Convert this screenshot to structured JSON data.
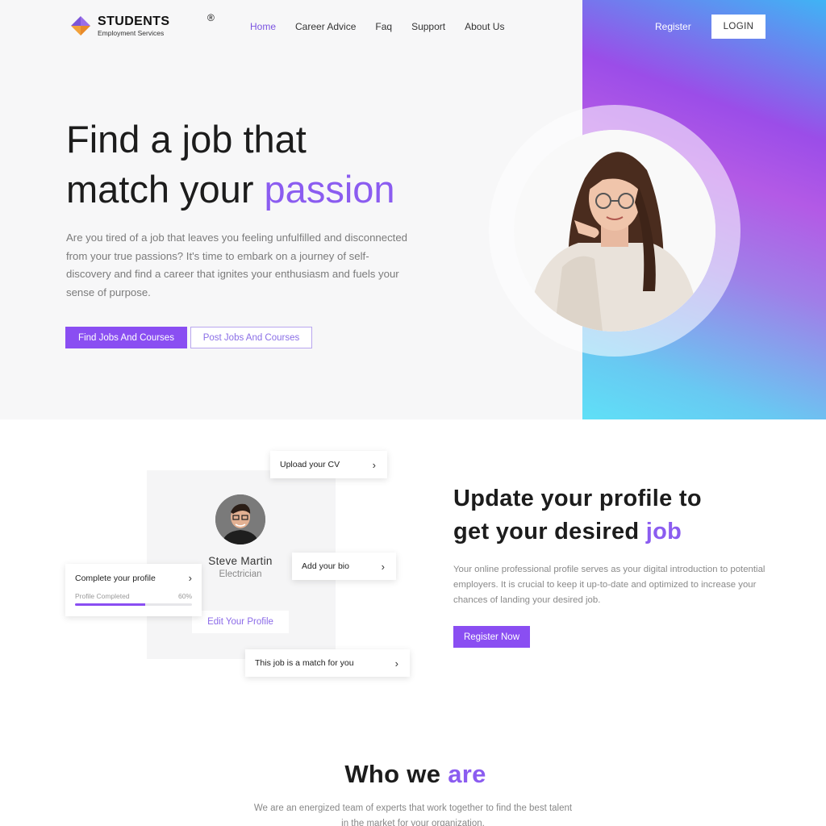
{
  "brand": {
    "name": "STUDENTS",
    "registered": "®",
    "subtitle": "Employment Services",
    "colors": {
      "primary": "#8a4ef2",
      "accent_text": "#8b5cf0",
      "gradient_start": "#3fb4f5",
      "gradient_end": "#5fe0f7"
    }
  },
  "nav": {
    "items": [
      {
        "label": "Home",
        "active": true
      },
      {
        "label": "Career Advice",
        "active": false
      },
      {
        "label": "Faq",
        "active": false
      },
      {
        "label": "Support",
        "active": false
      },
      {
        "label": "About Us",
        "active": false
      }
    ],
    "register_label": "Register",
    "login_label": "LOGIN"
  },
  "hero": {
    "title_line1": "Find a job that",
    "title_line2": "match your",
    "title_accent": "passion",
    "description": "Are you tired of a job that leaves you feeling unfulfilled and disconnected from your true passions? It's time to embark on a journey of self-discovery and find a career that ignites your enthusiasm and fuels your sense of purpose.",
    "primary_button": "Find Jobs And Courses",
    "secondary_button": "Post Jobs And Courses"
  },
  "profile_card": {
    "name": "Steve Martin",
    "role": "Electrician",
    "edit_button": "Edit Your Profile",
    "chips": {
      "upload_cv": "Upload your CV",
      "add_bio": "Add your bio",
      "job_match": "This job is a match for you"
    },
    "completion": {
      "title": "Complete your profile",
      "progress_label": "Profile Completed",
      "progress_text": "60%",
      "progress_value": 0.6
    }
  },
  "profile_section": {
    "title_line1": "Update your profile to",
    "title_line2": "get your desired",
    "title_accent": "job",
    "description": "Your online professional profile serves as your digital introduction to potential employers. It is crucial to keep it up-to-date and optimized to increase your chances of landing your desired job.",
    "button": "Register Now"
  },
  "who_we_are": {
    "title": "Who we",
    "title_accent": "are",
    "description": "We are an energized team of experts that work together to find the best talent in the market for your organization."
  },
  "icons": {
    "logo": "diamond-logo-icon",
    "chevron": "chevron-right-icon"
  }
}
